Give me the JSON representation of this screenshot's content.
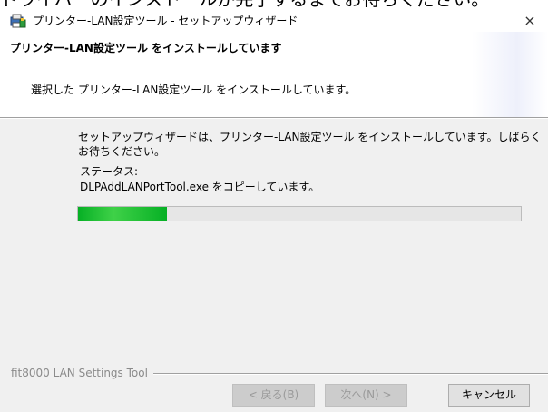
{
  "background_text": "ドライバーのインストールが完了するまでお待ちください。",
  "window": {
    "title": "プリンター-LAN設定ツール - セットアップウィザード",
    "close_glyph": "×"
  },
  "header": {
    "title": "プリンター-LAN設定ツール をインストールしています",
    "description": "選択した プリンター-LAN設定ツール をインストールしています。"
  },
  "body": {
    "message": "セットアップウィザードは、プリンター-LAN設定ツール をインストールしています。しばらくお待ちください。",
    "status_label": "ステータス:",
    "status_value": "DLPAddLANPortTool.exe をコピーしています。",
    "progress": 0.2
  },
  "footer": {
    "brand": "fit8000 LAN Settings Tool"
  },
  "buttons": {
    "back": "< 戻る(B)",
    "next": "次へ(N) >",
    "cancel": "キャンセル"
  },
  "colors": {
    "progress_fill": "#06b025",
    "header_bg": "#ffffff",
    "dialog_bg": "#f0f0f0"
  },
  "icons": {
    "app": "installer-icon",
    "close": "close-icon"
  }
}
